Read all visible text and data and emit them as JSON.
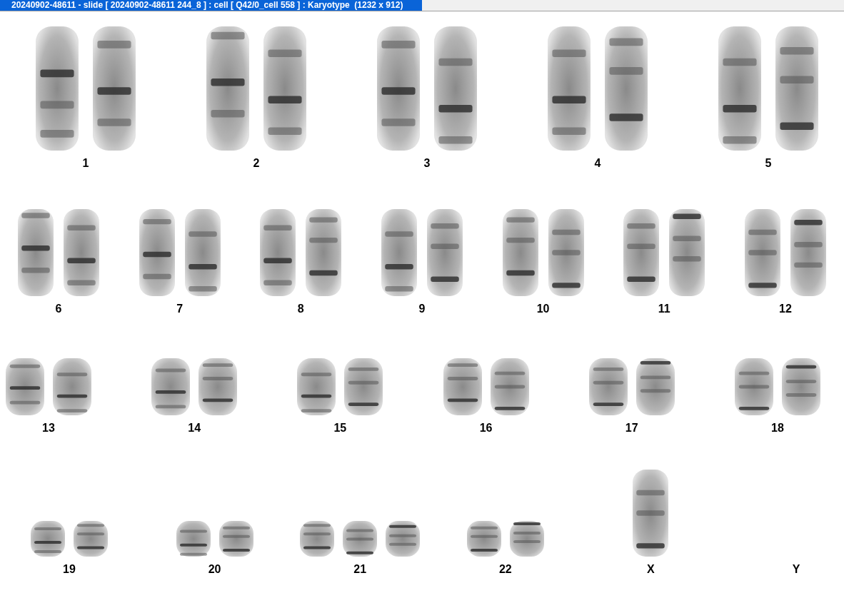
{
  "window": {
    "title": "20240902-48611 - slide [ 20240902-48611 244_8 ] : cell [ Q42/0_cell 558 ] : Karyotype  (1232 x 912)"
  },
  "karyotype": {
    "rows": [
      {
        "groups": [
          {
            "label": "1",
            "images": [
              {
                "kind": "large"
              },
              {
                "kind": "large"
              }
            ]
          },
          {
            "label": "2",
            "images": [
              {
                "kind": "large"
              },
              {
                "kind": "large"
              }
            ]
          },
          {
            "label": "3",
            "images": [
              {
                "kind": "large"
              },
              {
                "kind": "large"
              }
            ]
          },
          {
            "label": "4",
            "images": [
              {
                "kind": "large"
              },
              {
                "kind": "large"
              }
            ]
          },
          {
            "label": "5",
            "images": [
              {
                "kind": "large"
              },
              {
                "kind": "large"
              }
            ]
          }
        ]
      },
      {
        "groups": [
          {
            "label": "6",
            "images": [
              {
                "kind": "medium"
              },
              {
                "kind": "medium"
              }
            ]
          },
          {
            "label": "7",
            "images": [
              {
                "kind": "medium"
              },
              {
                "kind": "medium"
              }
            ]
          },
          {
            "label": "8",
            "images": [
              {
                "kind": "medium"
              },
              {
                "kind": "medium"
              }
            ]
          },
          {
            "label": "9",
            "images": [
              {
                "kind": "medium"
              },
              {
                "kind": "medium"
              }
            ]
          },
          {
            "label": "10",
            "images": [
              {
                "kind": "medium"
              },
              {
                "kind": "medium"
              }
            ]
          },
          {
            "label": "11",
            "images": [
              {
                "kind": "medium"
              },
              {
                "kind": "medium"
              }
            ]
          },
          {
            "label": "12",
            "images": [
              {
                "kind": "medium"
              },
              {
                "kind": "medium"
              }
            ]
          }
        ]
      },
      {
        "groups": [
          {
            "label": "13",
            "images": [
              {
                "kind": "small"
              },
              {
                "kind": "small"
              }
            ]
          },
          {
            "label": "14",
            "images": [
              {
                "kind": "small"
              },
              {
                "kind": "small"
              }
            ]
          },
          {
            "label": "15",
            "images": [
              {
                "kind": "small"
              },
              {
                "kind": "small"
              }
            ]
          },
          {
            "label": "16",
            "images": [
              {
                "kind": "small"
              },
              {
                "kind": "small"
              }
            ]
          },
          {
            "label": "17",
            "images": [
              {
                "kind": "small"
              },
              {
                "kind": "small"
              }
            ]
          },
          {
            "label": "18",
            "images": [
              {
                "kind": "small"
              },
              {
                "kind": "small"
              }
            ]
          }
        ]
      },
      {
        "groups": [
          {
            "label": "19",
            "images": [
              {
                "kind": "tiny"
              },
              {
                "kind": "tiny"
              }
            ]
          },
          {
            "label": "20",
            "images": [
              {
                "kind": "tiny"
              },
              {
                "kind": "tiny"
              }
            ]
          },
          {
            "label": "21",
            "images": [
              {
                "kind": "tiny"
              },
              {
                "kind": "tiny"
              },
              {
                "kind": "tiny"
              }
            ]
          },
          {
            "label": "22",
            "images": [
              {
                "kind": "tiny"
              },
              {
                "kind": "tiny"
              }
            ]
          },
          {
            "label": "X",
            "images": [
              {
                "kind": "medium"
              }
            ]
          },
          {
            "label": "Y"
          }
        ]
      }
    ]
  }
}
